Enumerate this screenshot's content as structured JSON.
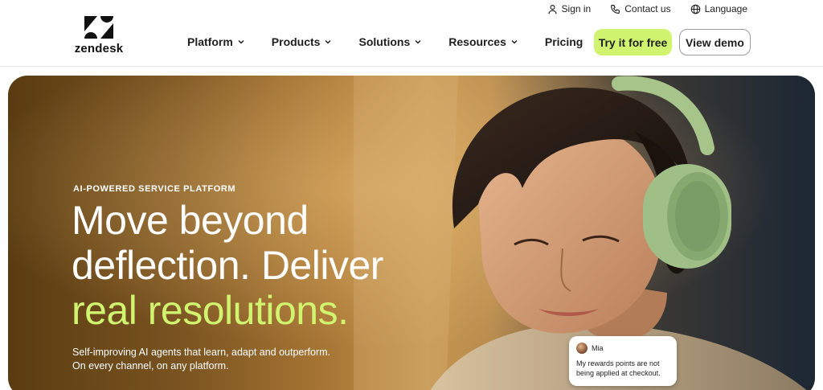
{
  "util_nav": {
    "sign_in": "Sign in",
    "contact": "Contact us",
    "language": "Language"
  },
  "brand": {
    "name": "zendesk"
  },
  "nav": {
    "items": [
      {
        "label": "Platform",
        "has_menu": true
      },
      {
        "label": "Products",
        "has_menu": true
      },
      {
        "label": "Solutions",
        "has_menu": true
      },
      {
        "label": "Resources",
        "has_menu": true
      },
      {
        "label": "Pricing",
        "has_menu": false
      }
    ]
  },
  "cta": {
    "try_label": "Try it for free",
    "demo_label": "View demo"
  },
  "hero": {
    "eyebrow": "AI-POWERED SERVICE PLATFORM",
    "headline_line1": "Move beyond",
    "headline_line2": "deflection. Deliver",
    "headline_accent": "real resolutions.",
    "subcopy_line1": "Self-improving AI agents that learn, adapt and outperform.",
    "subcopy_line2": "On every channel, on any platform."
  },
  "chat_card": {
    "author": "Mia",
    "message": "My rewards points are not being applied at checkout."
  },
  "colors": {
    "accent": "#d1f470",
    "text": "#1f1f1f"
  }
}
